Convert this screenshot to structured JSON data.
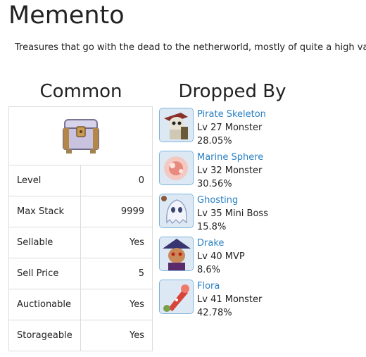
{
  "page": {
    "title": "Memento",
    "description": "Treasures that go with the dead to the netherworld, mostly of quite a high value. T"
  },
  "columns": {
    "common": "Common",
    "dropped_by": "Dropped By"
  },
  "item": {
    "icon": "treasure-chest-icon",
    "rows": [
      {
        "label": "Level",
        "value": "0"
      },
      {
        "label": "Max Stack",
        "value": "9999"
      },
      {
        "label": "Sellable",
        "value": "Yes"
      },
      {
        "label": "Sell Price",
        "value": "5"
      },
      {
        "label": "Auctionable",
        "value": "Yes"
      },
      {
        "label": "Storageable",
        "value": "Yes"
      }
    ]
  },
  "drops": [
    {
      "name": "Pirate Skeleton",
      "level": "Lv 27 Monster",
      "rate": "28.05%",
      "icon": "pirate-skeleton-icon"
    },
    {
      "name": "Marine Sphere",
      "level": "Lv 32 Monster",
      "rate": "30.56%",
      "icon": "marine-sphere-icon"
    },
    {
      "name": "Ghosting",
      "level": "Lv 35 Mini Boss",
      "rate": "15.8%",
      "icon": "ghosting-icon"
    },
    {
      "name": "Drake",
      "level": "Lv 40 MVP",
      "rate": "8.6%",
      "icon": "drake-icon"
    },
    {
      "name": "Flora",
      "level": "Lv 41 Monster",
      "rate": "42.78%",
      "icon": "flora-icon"
    }
  ],
  "colors": {
    "link": "#2a80c4",
    "border": "#dcdcdc",
    "avatar_border": "#7fb3d9"
  }
}
